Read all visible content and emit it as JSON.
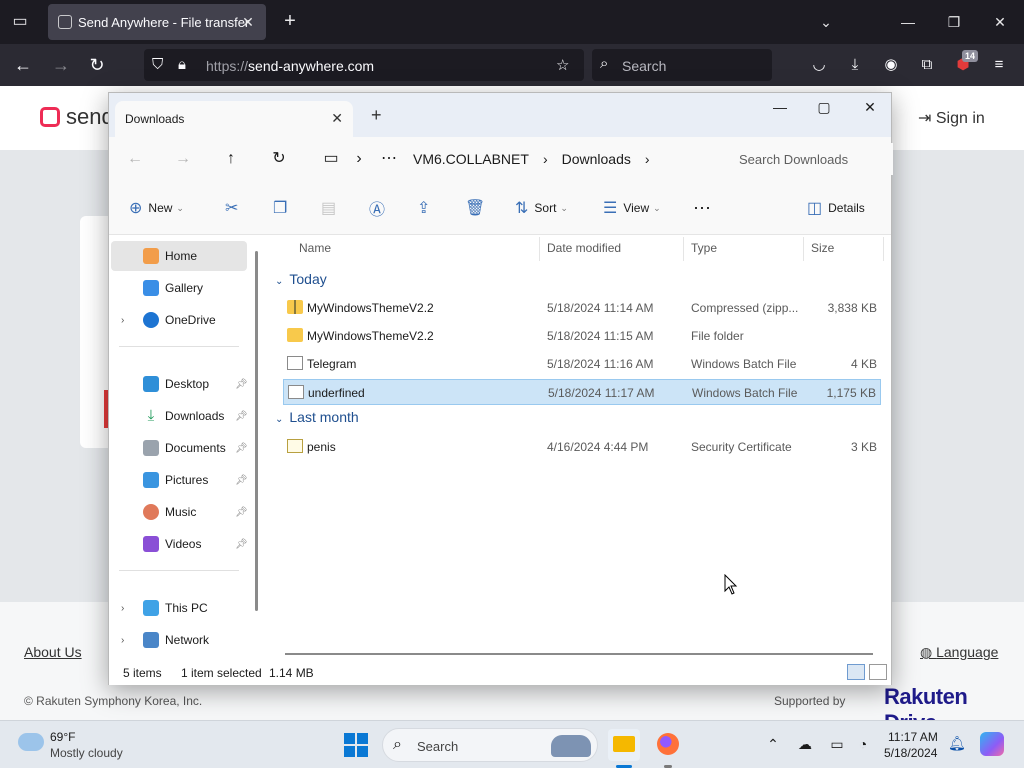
{
  "browser": {
    "tab_title": "Send Anywhere - File transfer",
    "url_prefix": "https://",
    "url_host": "send-anywhere.com",
    "search_placeholder": "Search",
    "extension_badge": "14"
  },
  "site": {
    "logo_text": "senda",
    "sign_in": "Sign in",
    "about": "About Us",
    "language": "Language",
    "copyright": "© Rakuten Symphony Korea, Inc.",
    "supported_by": "Supported by",
    "brand": "Rakuten Drive"
  },
  "explorer": {
    "tab_title": "Downloads",
    "breadcrumb": [
      "VM6.COLLABNET",
      "Downloads"
    ],
    "search_placeholder": "Search Downloads",
    "commands": {
      "new": "New",
      "sort": "Sort",
      "view": "View",
      "details": "Details"
    },
    "nav": {
      "home": "Home",
      "gallery": "Gallery",
      "onedrive": "OneDrive",
      "desktop": "Desktop",
      "downloads": "Downloads",
      "documents": "Documents",
      "pictures": "Pictures",
      "music": "Music",
      "videos": "Videos",
      "this_pc": "This PC",
      "network": "Network"
    },
    "columns": {
      "name": "Name",
      "date": "Date modified",
      "type": "Type",
      "size": "Size"
    },
    "groups": {
      "today": "Today",
      "last_month": "Last month"
    },
    "files": [
      {
        "name": "MyWindowsThemeV2.2",
        "date": "5/18/2024 11:14 AM",
        "type": "Compressed (zipp...",
        "size": "3,838 KB",
        "icon": "zip-folder-icon"
      },
      {
        "name": "MyWindowsThemeV2.2",
        "date": "5/18/2024 11:15 AM",
        "type": "File folder",
        "size": "",
        "icon": "folder-icon"
      },
      {
        "name": "Telegram",
        "date": "5/18/2024 11:16 AM",
        "type": "Windows Batch File",
        "size": "4 KB",
        "icon": "batch-file-icon"
      },
      {
        "name": "underfined",
        "date": "5/18/2024 11:17 AM",
        "type": "Windows Batch File",
        "size": "1,175 KB",
        "icon": "batch-file-icon",
        "selected": true
      },
      {
        "name": "penis",
        "date": "4/16/2024 4:44 PM",
        "type": "Security Certificate",
        "size": "3 KB",
        "icon": "certificate-icon"
      }
    ],
    "status": {
      "items": "5 items",
      "selected": "1 item selected",
      "size": "1.14 MB"
    }
  },
  "taskbar": {
    "temperature": "69°F",
    "condition": "Mostly cloudy",
    "search_label": "Search",
    "time": "11:17 AM",
    "date": "5/18/2024"
  }
}
